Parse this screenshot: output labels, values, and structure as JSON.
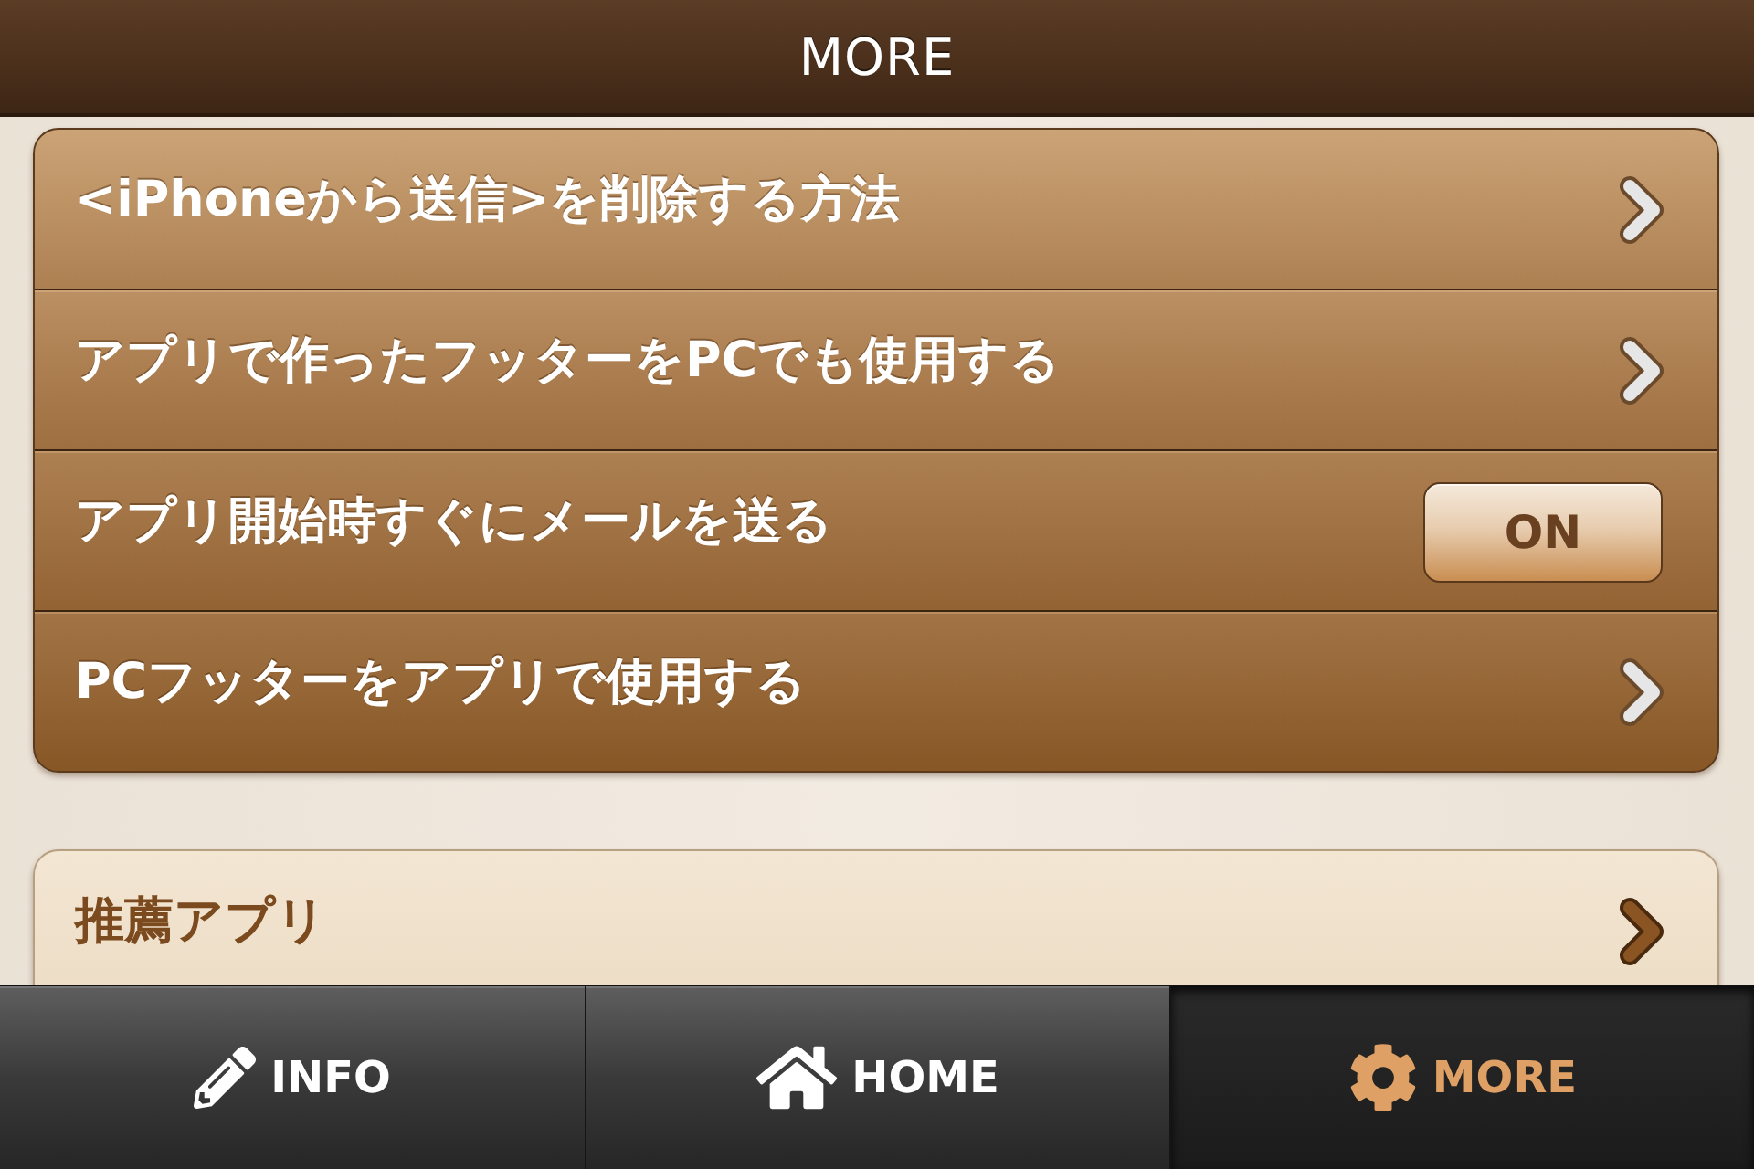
{
  "header": {
    "title": "MORE"
  },
  "settings": [
    {
      "kind": "link",
      "label": "<iPhoneから送信>を削除する方法"
    },
    {
      "kind": "link",
      "label": "アプリで作ったフッターをPCでも使用する"
    },
    {
      "kind": "toggle",
      "label": "アプリ開始時すぐにメールを送る",
      "toggle_label": "ON",
      "on": true
    },
    {
      "kind": "link",
      "label": "PCフッターをアプリで使用する"
    }
  ],
  "recommended": [
    {
      "kind": "link",
      "label": "推薦アプリ"
    }
  ],
  "tab_bar": [
    {
      "label": "INFO",
      "selected": false
    },
    {
      "label": "HOME",
      "selected": false
    },
    {
      "label": "MORE",
      "selected": true
    }
  ]
}
